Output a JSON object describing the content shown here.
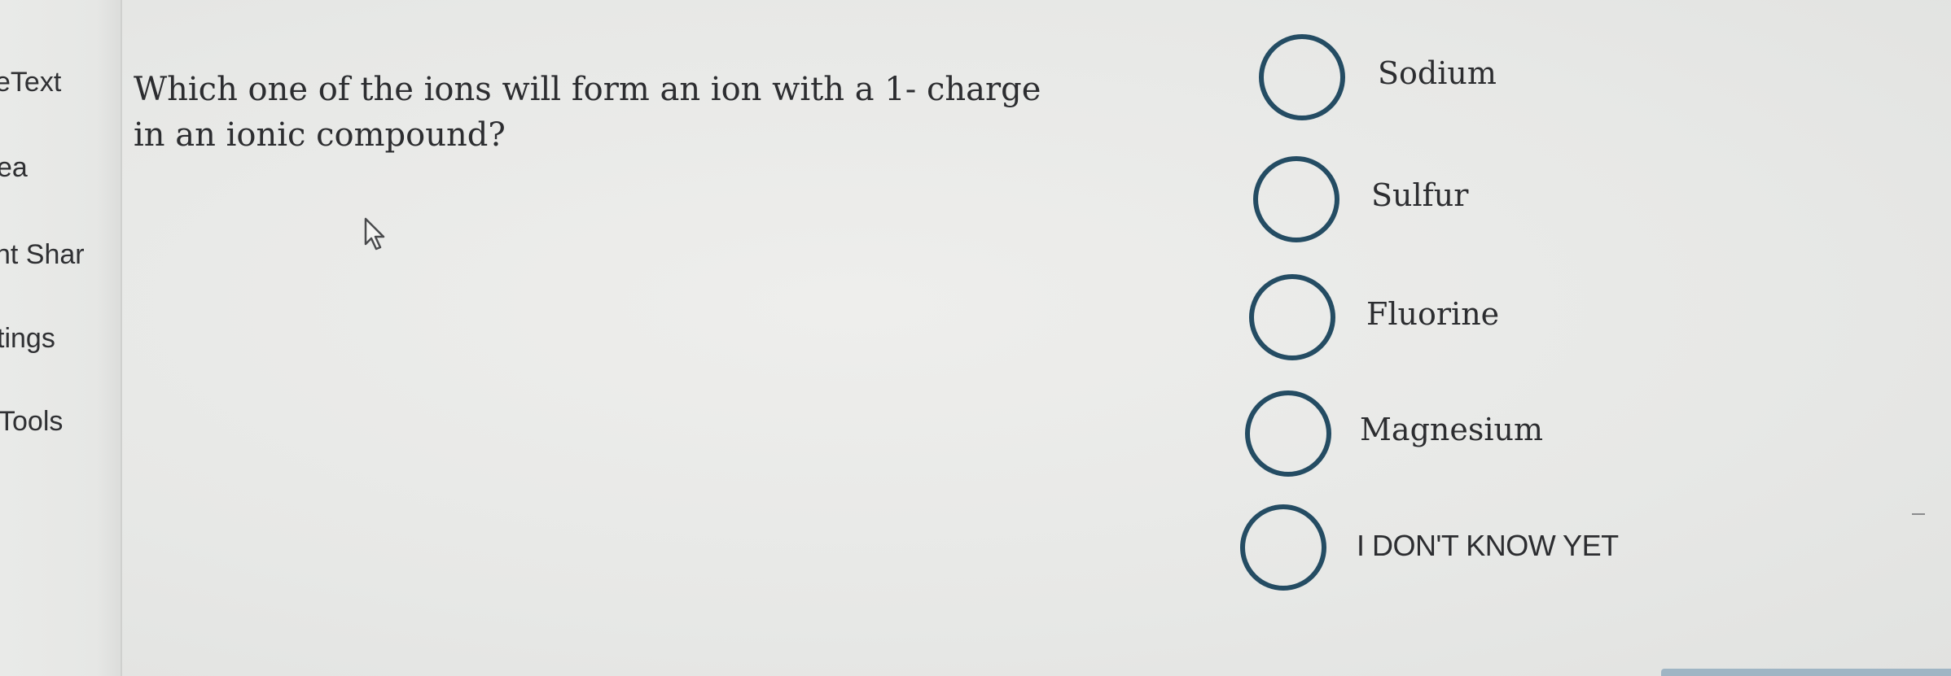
{
  "sidebar": {
    "items": [
      {
        "label": "eText"
      },
      {
        "label": "ea"
      },
      {
        "label": "nt Shar"
      },
      {
        "label": "tings"
      },
      {
        "label": "Tools"
      }
    ]
  },
  "question": {
    "text": "Which one of the ions will form an ion with a 1- charge in an ionic compound?"
  },
  "options": [
    {
      "label": "Sodium"
    },
    {
      "label": "Sulfur"
    },
    {
      "label": "Fluorine"
    },
    {
      "label": "Magnesium"
    },
    {
      "label": "I DON'T KNOW YET"
    }
  ],
  "colors": {
    "radio_border": "#244c63",
    "text": "#2c2d30",
    "background": "#e7e8e6"
  }
}
